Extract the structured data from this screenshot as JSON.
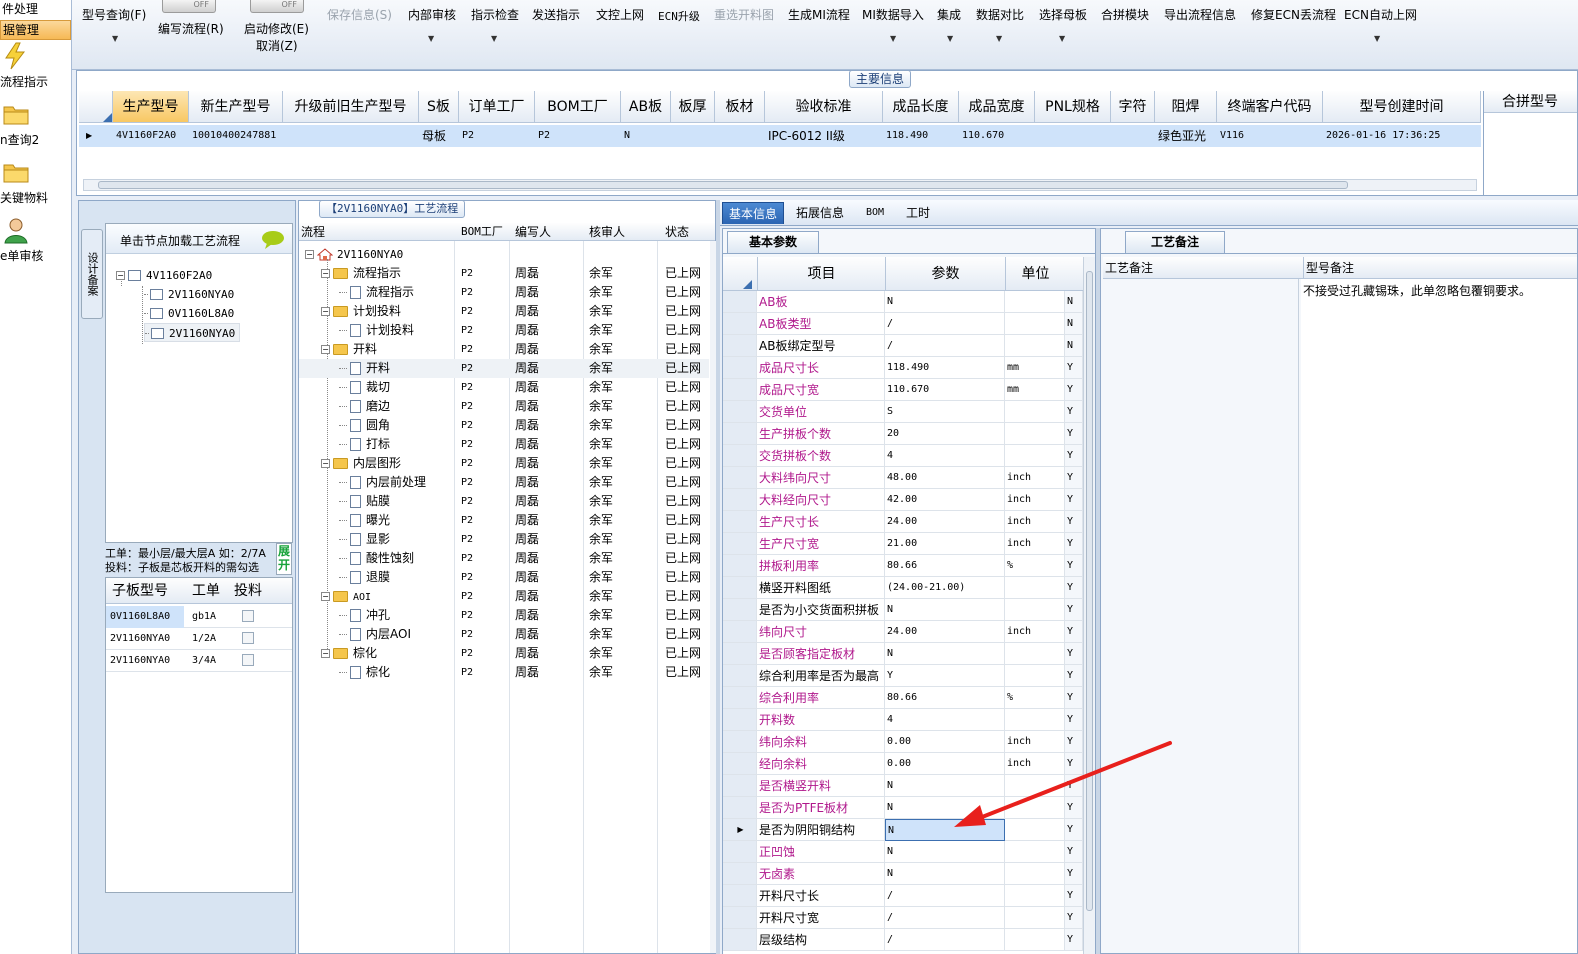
{
  "leftnav": {
    "top_items": [
      "件处理",
      "据管理"
    ],
    "items": [
      {
        "label": "流程指示",
        "icon": "lightning-icon"
      },
      {
        "label": "n查询2",
        "icon": "folder-icon"
      },
      {
        "label": "关键物料",
        "icon": "folder-icon"
      },
      {
        "label": "e单审核",
        "icon": "user-icon"
      }
    ]
  },
  "toolbar": {
    "toggle_off": "OFF",
    "buttons": [
      {
        "label": "型号查询(F)",
        "dropdown": true,
        "disabled": false
      },
      {
        "label": "编写流程(R)",
        "dropdown": false,
        "disabled": false
      },
      {
        "label": "启动修改(E)",
        "sub": "取消(Z)",
        "dropdown": false,
        "disabled": false
      },
      {
        "label": "保存信息(S)",
        "dropdown": false,
        "disabled": true
      },
      {
        "label": "内部审核",
        "dropdown": true,
        "disabled": false
      },
      {
        "label": "指示检查",
        "dropdown": true,
        "disabled": false
      },
      {
        "label": "发送指示",
        "dropdown": false,
        "disabled": false
      },
      {
        "label": "文控上网",
        "dropdown": false,
        "disabled": false
      },
      {
        "label": "ECN升级",
        "dropdown": false,
        "disabled": false
      },
      {
        "label": "重选开料图",
        "dropdown": false,
        "disabled": true
      },
      {
        "label": "生成MI流程",
        "dropdown": false,
        "disabled": false
      },
      {
        "label": "MI数据导入",
        "dropdown": true,
        "disabled": false
      },
      {
        "label": "集成",
        "dropdown": true,
        "disabled": false
      },
      {
        "label": "数据对比",
        "dropdown": true,
        "disabled": false
      },
      {
        "label": "选择母板",
        "dropdown": true,
        "disabled": false
      },
      {
        "label": "合拼模块",
        "dropdown": false,
        "disabled": false
      },
      {
        "label": "导出流程信息",
        "dropdown": false,
        "disabled": false
      },
      {
        "label": "修复ECN丢流程",
        "dropdown": false,
        "disabled": false
      },
      {
        "label": "ECN自动上网",
        "dropdown": true,
        "disabled": false
      }
    ]
  },
  "main": {
    "section_title": "主要信息",
    "side_header": "合拼型号",
    "headers": [
      "生产型号",
      "新生产型号",
      "升级前旧生产型号",
      "S板",
      "订单工厂",
      "BOM工厂",
      "AB板",
      "板厚",
      "板材",
      "验收标准",
      "成品长度",
      "成品宽度",
      "PNL规格",
      "字符",
      "阻焊",
      "终端客户代码",
      "型号创建时间"
    ],
    "row": [
      "4V1160F2A0",
      "10010400247881",
      "",
      "母板",
      "P2",
      "P2",
      "N",
      "",
      "",
      "IPC-6012 II级",
      "118.490",
      "110.670",
      "",
      "",
      "绿色亚光",
      "V116",
      "2026-01-16 17:36:25"
    ]
  },
  "left": {
    "vertical_tab": "设计备案",
    "hint": "单击节点加载工艺流程",
    "tree": [
      "4V1160F2A0",
      "2V1160NYA0",
      "0V1160L8A0",
      "2V1160NYA0"
    ],
    "note_line1": "工单：最小层/最大层A 如：2/7A",
    "note_line2": "投料：子板是芯板开料的需勾选",
    "expand_btn": "展开",
    "sub_headers": [
      "子板型号",
      "工单",
      "投料"
    ],
    "sub_rows": [
      [
        "0V1160L8A0",
        "gb1A"
      ],
      [
        "2V1160NYA0",
        "1/2A"
      ],
      [
        "2V1160NYA0",
        "3/4A"
      ]
    ]
  },
  "flow": {
    "title": "【2V1160NYA0】工艺流程",
    "headers": [
      "流程",
      "BOM工厂",
      "编写人",
      "核审人",
      "状态"
    ],
    "root": "2V1160NYA0",
    "rows": [
      {
        "name": "流程指示",
        "level": 1
      },
      {
        "name": "流程指示",
        "level": 2
      },
      {
        "name": "计划投料",
        "level": 1
      },
      {
        "name": "计划投料",
        "level": 2
      },
      {
        "name": "开料",
        "level": 1
      },
      {
        "name": "开料",
        "level": 2
      },
      {
        "name": "裁切",
        "level": 2
      },
      {
        "name": "磨边",
        "level": 2
      },
      {
        "name": "圆角",
        "level": 2
      },
      {
        "name": "打标",
        "level": 2
      },
      {
        "name": "内层图形",
        "level": 1
      },
      {
        "name": "内层前处理",
        "level": 2
      },
      {
        "name": "贴膜",
        "level": 2
      },
      {
        "name": "曝光",
        "level": 2
      },
      {
        "name": "显影",
        "level": 2
      },
      {
        "name": "酸性蚀刻",
        "level": 2
      },
      {
        "name": "退膜",
        "level": 2
      },
      {
        "name": "AOI",
        "level": 1
      },
      {
        "name": "冲孔",
        "level": 2
      },
      {
        "name": "内层AOI",
        "level": 2
      },
      {
        "name": "棕化",
        "level": 1
      },
      {
        "name": "棕化",
        "level": 2
      }
    ],
    "bom": "P2",
    "writer": "周磊",
    "checker": "余军",
    "status": "已上网"
  },
  "right": {
    "tabs": [
      "基本信息",
      "拓展信息",
      "BOM",
      "工时"
    ],
    "sub_tab": "基本参数",
    "headers": [
      "项目",
      "参数",
      "单位"
    ],
    "params": [
      [
        "AB板",
        "N",
        "",
        "N",
        true
      ],
      [
        "AB板类型",
        "/",
        "",
        "N",
        true
      ],
      [
        "AB板绑定型号",
        "/",
        "",
        "N",
        false
      ],
      [
        "成品尺寸长",
        "118.490",
        "mm",
        "Y",
        true
      ],
      [
        "成品尺寸宽",
        "110.670",
        "mm",
        "Y",
        true
      ],
      [
        "交货单位",
        "S",
        "",
        "Y",
        true
      ],
      [
        "生产拼板个数",
        "20",
        "",
        "Y",
        true
      ],
      [
        "交货拼板个数",
        "4",
        "",
        "Y",
        true
      ],
      [
        "大料纬向尺寸",
        "48.00",
        "inch",
        "Y",
        true
      ],
      [
        "大料经向尺寸",
        "42.00",
        "inch",
        "Y",
        true
      ],
      [
        "生产尺寸长",
        "24.00",
        "inch",
        "Y",
        true
      ],
      [
        "生产尺寸宽",
        "21.00",
        "inch",
        "Y",
        true
      ],
      [
        "拼板利用率",
        "80.66",
        "%",
        "Y",
        true
      ],
      [
        "横竖开料图纸",
        "(24.00-21.00)",
        "",
        "Y",
        false
      ],
      [
        "是否为小交货面积拼板",
        "N",
        "",
        "Y",
        false
      ],
      [
        "纬向尺寸",
        "24.00",
        "inch",
        "Y",
        true
      ],
      [
        "是否顾客指定板材",
        "N",
        "",
        "Y",
        true
      ],
      [
        "综合利用率是否为最高",
        "Y",
        "",
        "Y",
        false
      ],
      [
        "综合利用率",
        "80.66",
        "%",
        "Y",
        true
      ],
      [
        "开料数",
        "4",
        "",
        "Y",
        true
      ],
      [
        "纬向余料",
        "0.00",
        "inch",
        "Y",
        true
      ],
      [
        "经向余料",
        "0.00",
        "inch",
        "Y",
        true
      ],
      [
        "是否横竖开料",
        "N",
        "",
        "Y",
        true
      ],
      [
        "是否为PTFE板材",
        "N",
        "",
        "Y",
        true
      ],
      [
        "是否为阴阳铜结构",
        "N",
        "",
        "Y",
        false
      ],
      [
        "正凹蚀",
        "N",
        "",
        "Y",
        true
      ],
      [
        "无卤素",
        "N",
        "",
        "Y",
        true
      ],
      [
        "开料尺寸长",
        "/",
        "",
        "Y",
        false
      ],
      [
        "开料尺寸宽",
        "/",
        "",
        "Y",
        false
      ],
      [
        "层级结构",
        "/",
        "",
        "Y",
        false
      ]
    ],
    "notes_tab": "工艺备注",
    "notes_headers": [
      "工艺备注",
      "型号备注"
    ],
    "model_note": "不接受过孔藏锡珠，此单忽略包覆铜要求。"
  },
  "colors": {
    "magenta": "#b0188c",
    "selection": "#cfe3fa",
    "arrow": "#e8201c"
  }
}
